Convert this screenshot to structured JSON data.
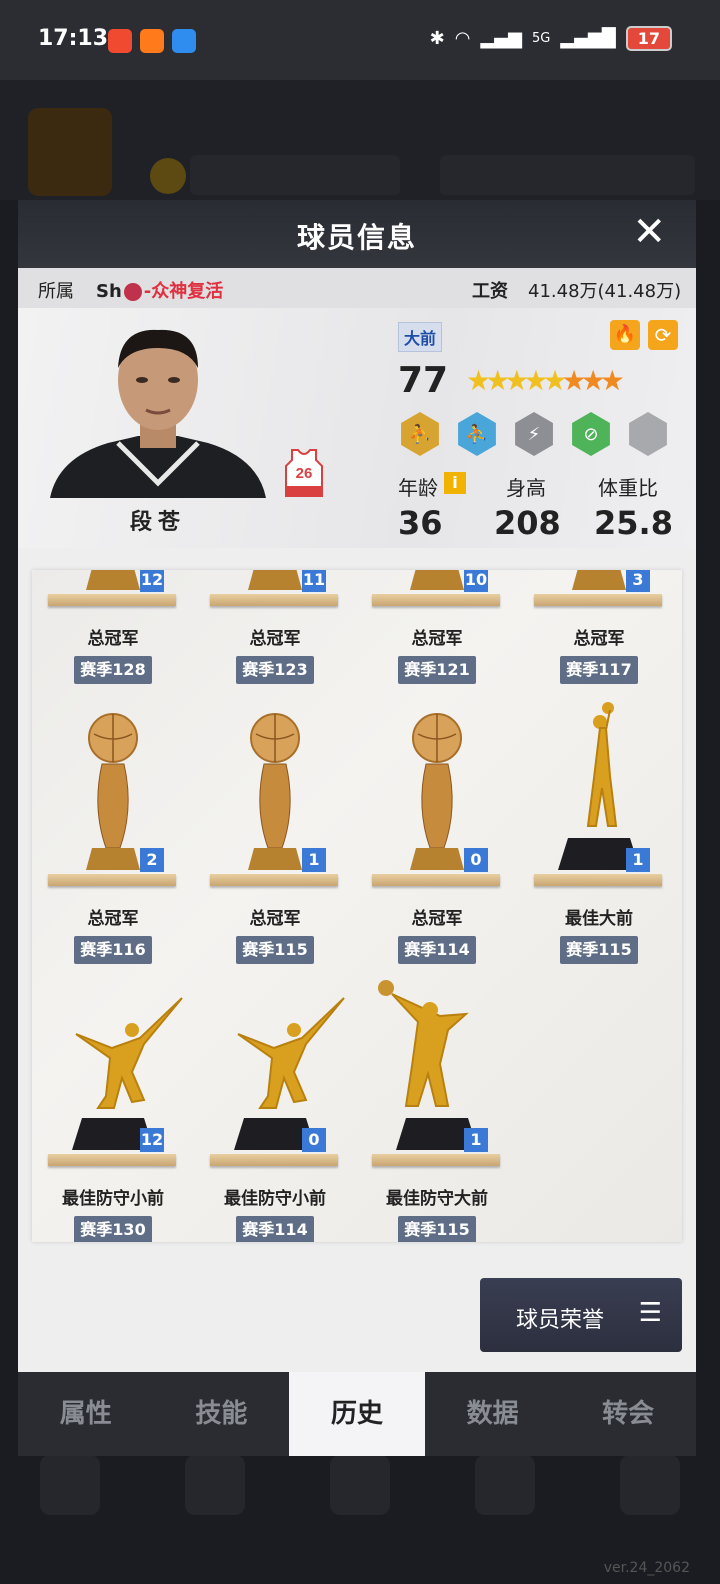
{
  "status_bar": {
    "time": "17:13",
    "network": "5G",
    "battery": "17"
  },
  "modal": {
    "title": "球员信息",
    "close_label": "✕"
  },
  "info_row": {
    "team_label": "所属",
    "team_prefix": "Sh",
    "team_name": "-众神复活",
    "salary_label": "工资",
    "salary_value": "41.48万(41.48万)"
  },
  "player": {
    "name": "段苍",
    "jersey_number": "26",
    "position": "大前",
    "rating": "77",
    "stars_gold": 5,
    "stars_orange": 3,
    "age_label": "年龄",
    "age": "36",
    "height_label": "身高",
    "height": "208",
    "weight_label": "体重比",
    "weight": "25.8",
    "info_icon": "i"
  },
  "trophies": [
    {
      "name": "总冠军",
      "season": "赛季128",
      "count": "12",
      "type": "cup"
    },
    {
      "name": "总冠军",
      "season": "赛季123",
      "count": "11",
      "type": "cup"
    },
    {
      "name": "总冠军",
      "season": "赛季121",
      "count": "10",
      "type": "cup"
    },
    {
      "name": "总冠军",
      "season": "赛季117",
      "count": "3",
      "type": "cup"
    },
    {
      "name": "总冠军",
      "season": "赛季116",
      "count": "2",
      "type": "cup"
    },
    {
      "name": "总冠军",
      "season": "赛季115",
      "count": "1",
      "type": "cup"
    },
    {
      "name": "总冠军",
      "season": "赛季114",
      "count": "0",
      "type": "cup"
    },
    {
      "name": "最佳大前",
      "season": "赛季115",
      "count": "1",
      "type": "statue-shoot"
    },
    {
      "name": "最佳防守小前",
      "season": "赛季130",
      "count": "12",
      "type": "statue-block"
    },
    {
      "name": "最佳防守小前",
      "season": "赛季114",
      "count": "0",
      "type": "statue-block"
    },
    {
      "name": "最佳防守大前",
      "season": "赛季115",
      "count": "1",
      "type": "statue-rebound"
    }
  ],
  "honor_button": {
    "label": "球员荣誉",
    "menu_icon": "☰"
  },
  "tabs": [
    {
      "label": "属性"
    },
    {
      "label": "技能"
    },
    {
      "label": "历史",
      "active": true
    },
    {
      "label": "数据"
    },
    {
      "label": "转会"
    }
  ],
  "version": "ver.24_2062"
}
